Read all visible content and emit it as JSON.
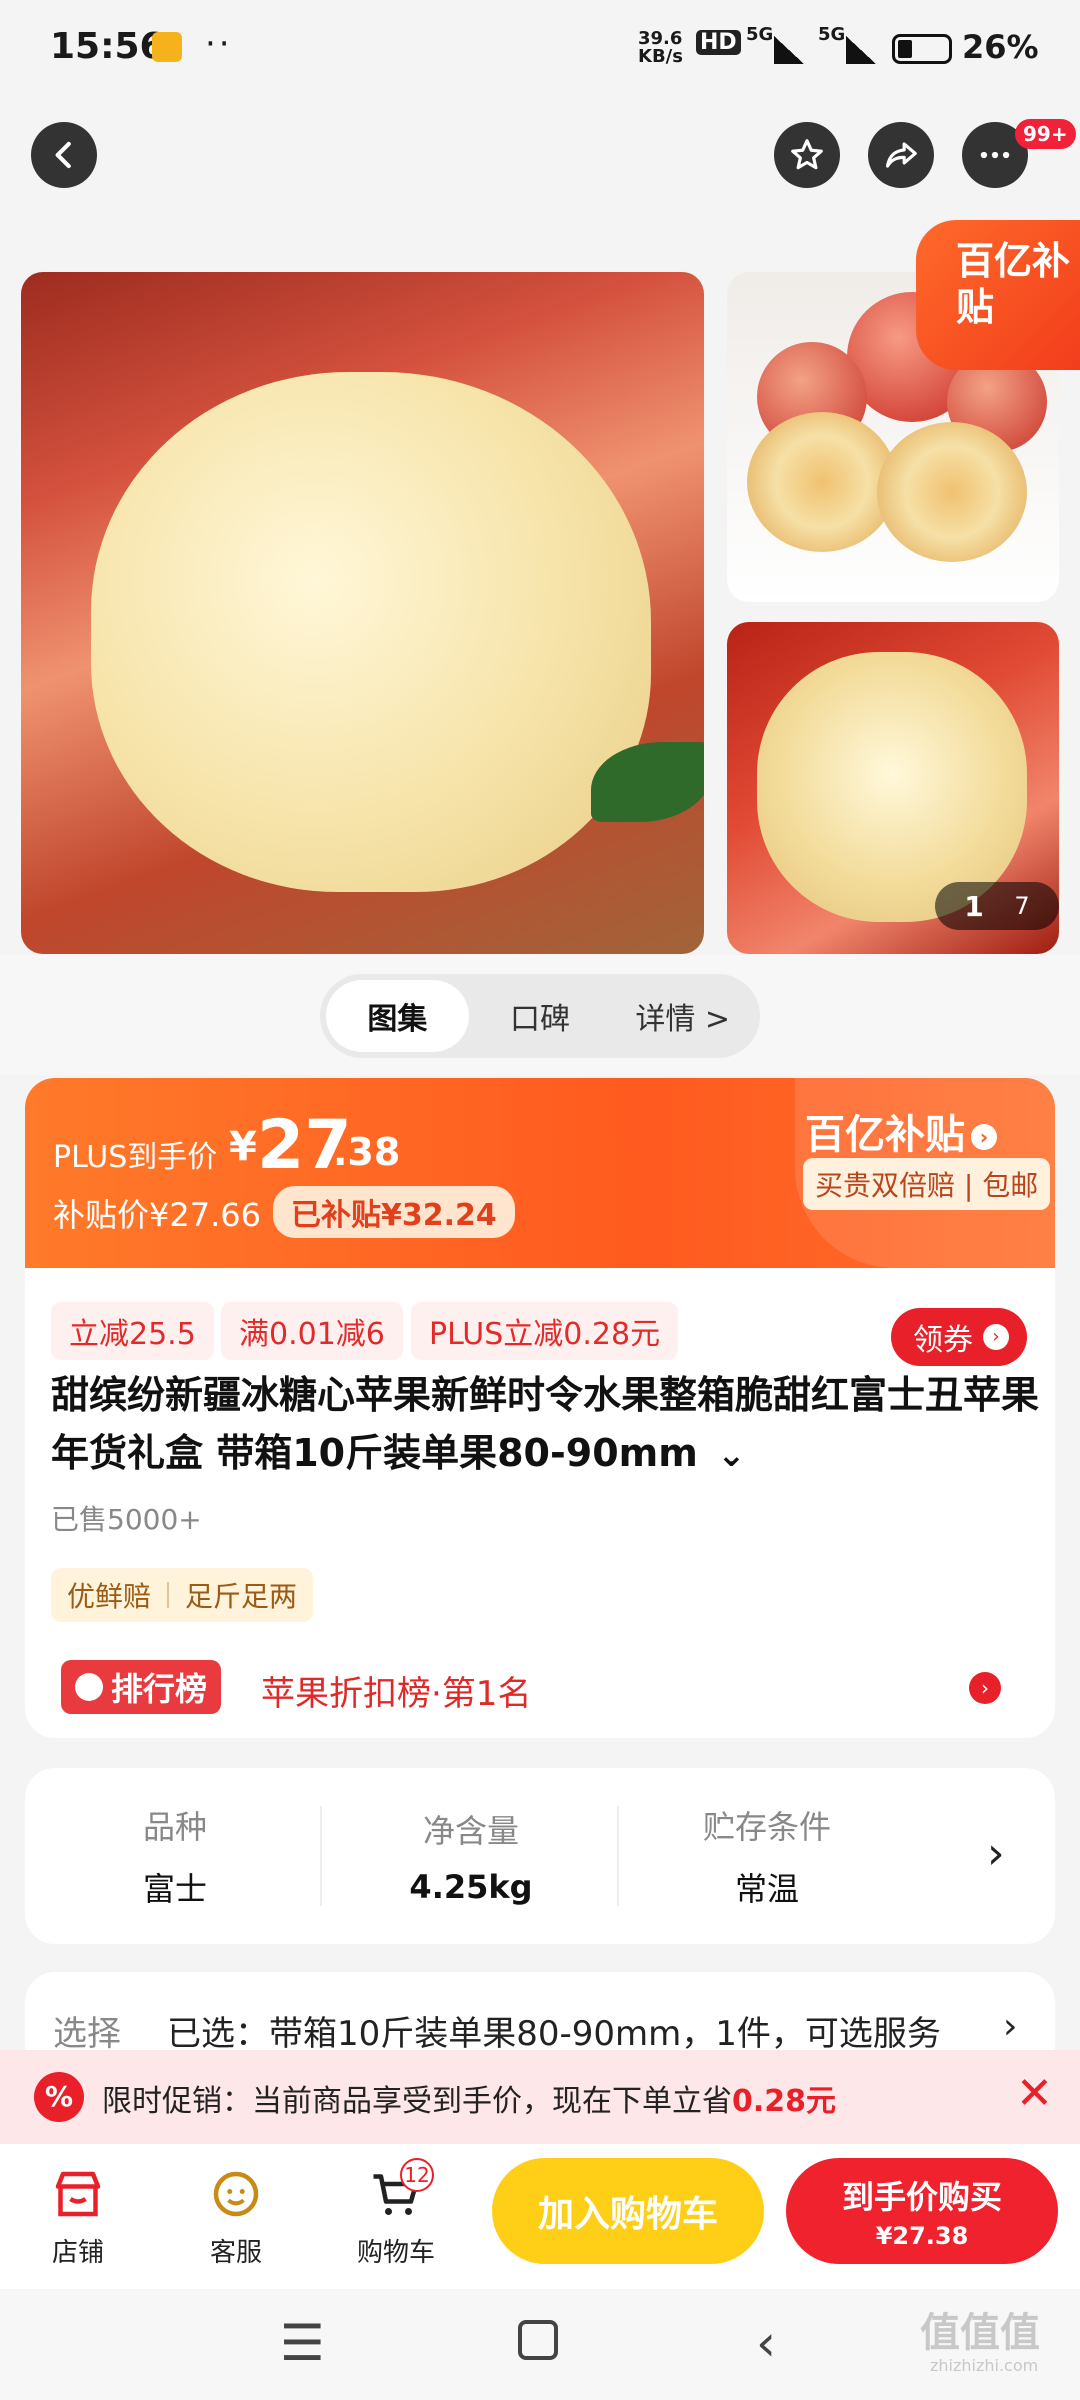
{
  "status_bar": {
    "time": "15:56",
    "dots": "··",
    "net_speed_top": "39.6",
    "net_speed_bottom": "KB/s",
    "hd": "HD",
    "signal1": "5G",
    "signal2": "5G",
    "battery": "26%"
  },
  "top_actions": {
    "badge": "99+"
  },
  "gallery": {
    "subsidy_corner": "百亿补贴",
    "counter_current": "1",
    "counter_total": "7"
  },
  "tabs": [
    {
      "label": "图集",
      "active": true
    },
    {
      "label": "口碑",
      "active": false
    },
    {
      "label": "详情 >",
      "active": false
    }
  ],
  "price": {
    "plus_label": "PLUS到手价",
    "currency": "¥",
    "plus_int": "27",
    "plus_dec": ".38",
    "subsidy_price": "补贴价¥27.66",
    "subsidy_saved": "已补贴¥32.24",
    "brand": "百亿补贴",
    "brand_tags": "买贵双倍赔 | 包邮"
  },
  "coupons": [
    "立减25.5",
    "满0.01减6",
    "PLUS立减0.28元"
  ],
  "get_coupon": "领券",
  "product": {
    "title": "甜缤纷新疆冰糖心苹果新鲜时令水果整箱脆甜红富士丑苹果年货礼盒 带箱10斤装单果80-90mm",
    "title_chevron": "⌄",
    "sold": "已售5000+",
    "guarantee_1": "优鲜赔",
    "guarantee_2": "足斤足两",
    "rank_badge": "排行榜",
    "rank_text": "苹果折扣榜·第1名"
  },
  "specs": [
    {
      "key": "品种",
      "value": "富士"
    },
    {
      "key": "净含量",
      "value": "4.25kg"
    },
    {
      "key": "贮存条件",
      "value": "常温"
    }
  ],
  "select": {
    "label": "选择",
    "value": "已选：带箱10斤装单果80-90mm，1件，可选服务"
  },
  "promo": {
    "text_prefix": "限时促销：当前商品享受到手价，现在下单立省",
    "highlight": "0.28元"
  },
  "bottom_bar": {
    "shop": "店铺",
    "service": "客服",
    "cart": "购物车",
    "cart_count": "12",
    "add_cart": "加入购物车",
    "buy_title": "到手价购买",
    "buy_price": "¥27.38"
  },
  "watermark": {
    "main": "值值值",
    "sub": "zhizhizhi.com"
  },
  "colors": {
    "accent_red": "#f0222e",
    "accent_orange": "#ff5a1f",
    "accent_yellow": "#ffcf18"
  }
}
